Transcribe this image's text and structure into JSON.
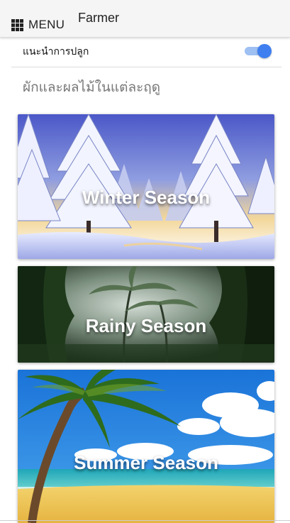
{
  "header": {
    "menu_label": "MENU",
    "title": "Farmer"
  },
  "toggle": {
    "label": "แนะนำการปลูก",
    "on": true,
    "color": "#3f7ff0"
  },
  "section": {
    "heading": "ผักและผลไม้ในแต่ละฤดู"
  },
  "seasons": [
    {
      "label": "Winter Season"
    },
    {
      "label": "Rainy Season"
    },
    {
      "label": "Summer Season"
    }
  ]
}
